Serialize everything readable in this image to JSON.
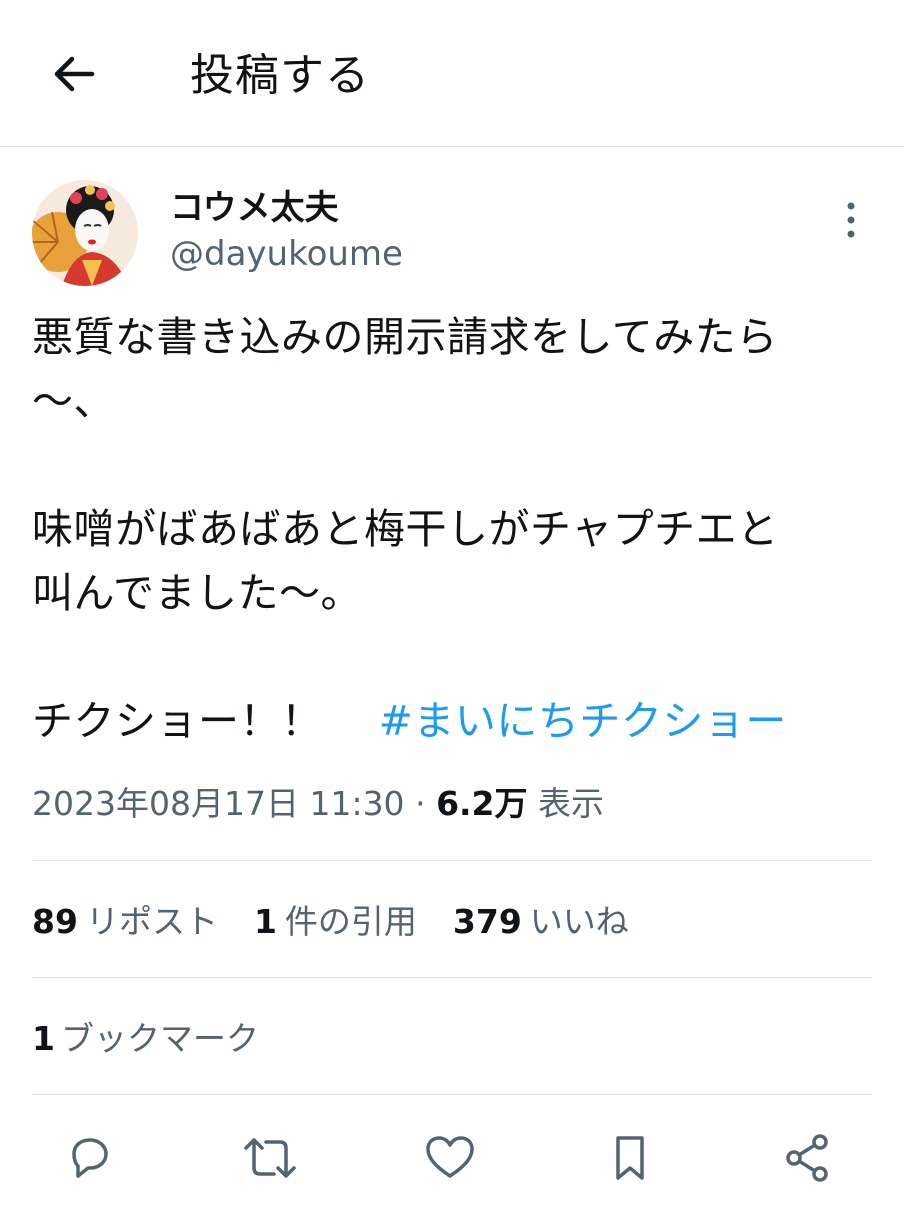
{
  "header": {
    "title": "投稿する",
    "back_icon": "arrow-left-icon"
  },
  "tweet": {
    "display_name": "コウメ太夫",
    "handle": "@dayukoume",
    "text_lines": [
      "悪質な書き込みの開示請求をしてみたら",
      "〜、",
      "",
      "味噌がばあばあと梅干しがチャプチエと",
      "叫んでました〜。",
      ""
    ],
    "last_line": "チクショー！！",
    "hashtag": "#まいにちチクショー",
    "timestamp": "2023年08月17日 11:30",
    "separator": "·",
    "views_count": "6.2万",
    "views_label": "表示"
  },
  "stats": {
    "reposts_count": "89",
    "reposts_label": "リポスト",
    "quotes_count": "1",
    "quotes_label": "件の引用",
    "likes_count": "379",
    "likes_label": "いいね",
    "bookmarks_count": "1",
    "bookmarks_label": "ブックマーク"
  },
  "actions": [
    "reply-icon",
    "repost-icon",
    "like-icon",
    "bookmark-icon",
    "share-icon"
  ],
  "colors": {
    "text": "#0f1419",
    "secondary": "#536471",
    "hashtag": "#1d9bf0",
    "divider": "#dfe3e6"
  }
}
